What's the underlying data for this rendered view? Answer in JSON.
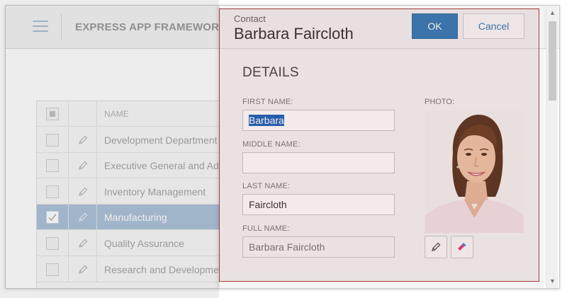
{
  "app": {
    "title": "EXPRESS APP FRAMEWORK"
  },
  "grid": {
    "header": "NAME",
    "rows": [
      {
        "name": "Development Department",
        "selected": false
      },
      {
        "name": "Executive General and Administration",
        "selected": false
      },
      {
        "name": "Inventory Management",
        "selected": false
      },
      {
        "name": "Manufacturing",
        "selected": true
      },
      {
        "name": "Quality Assurance",
        "selected": false
      },
      {
        "name": "Research and Development",
        "selected": false
      }
    ]
  },
  "dialog": {
    "subtitle": "Contact",
    "title": "Barbara Faircloth",
    "ok_label": "OK",
    "cancel_label": "Cancel",
    "section": "DETAILS",
    "fields": {
      "first_name_label": "FIRST NAME:",
      "first_name_value": "Barbara",
      "middle_name_label": "MIDDLE NAME:",
      "middle_name_value": "",
      "last_name_label": "LAST NAME:",
      "last_name_value": "Faircloth",
      "full_name_label": "FULL NAME:",
      "full_name_value": "Barbara Faircloth"
    },
    "photo_label": "PHOTO:"
  },
  "colors": {
    "accent": "#337ab7",
    "selected_row": "#aec3da",
    "highlight_border": "#a33a3a"
  },
  "icons": {
    "menu": "hamburger-icon",
    "edit": "pencil-icon",
    "clear": "eraser-icon",
    "check": "checkmark-icon"
  }
}
